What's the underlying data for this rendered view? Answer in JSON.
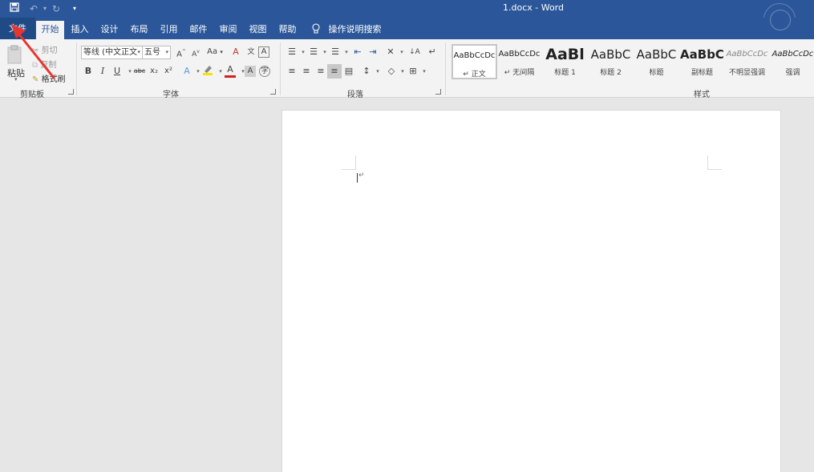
{
  "title_bar": {
    "title": "1.docx  -  Word"
  },
  "tabs": {
    "file": "文件",
    "items": [
      "开始",
      "插入",
      "设计",
      "布局",
      "引用",
      "邮件",
      "审阅",
      "视图",
      "帮助"
    ],
    "active": "开始",
    "tell_me": "操作说明搜索"
  },
  "clipboard": {
    "paste": "粘贴",
    "cut": "剪切",
    "copy": "复制",
    "format_painter": "格式刷",
    "label": "剪贴板"
  },
  "font": {
    "font_name": "等线 (中文正文",
    "font_size": "五号",
    "label": "字体",
    "bold": "B",
    "italic": "I",
    "underline": "U",
    "strike": "abc",
    "subscript": "x₂",
    "superscript": "x²",
    "grow": "A",
    "shrink": "A",
    "change_case": "Aa",
    "font_color_letter": "A",
    "highlight_color": "#f5e400",
    "font_color": "#d42020"
  },
  "paragraph": {
    "label": "段落"
  },
  "styles": {
    "label": "样式",
    "items": [
      {
        "sample": "AaBbCcDc",
        "name": "↵ 正文"
      },
      {
        "sample": "AaBbCcDc",
        "name": "↵ 无间隔"
      },
      {
        "sample": "AaBl",
        "name": "标题 1"
      },
      {
        "sample": "AaBbC",
        "name": "标题 2"
      },
      {
        "sample": "AaBbC",
        "name": "标题"
      },
      {
        "sample": "AaBbC",
        "name": "副标题"
      },
      {
        "sample": "AaBbCcDc",
        "name": "不明显强调"
      },
      {
        "sample": "AaBbCcDc",
        "name": "强调"
      }
    ]
  },
  "document": {
    "paragraph_mark": "↵"
  },
  "colors": {
    "accent": "#2b579a",
    "annotation": "#e8362f"
  }
}
